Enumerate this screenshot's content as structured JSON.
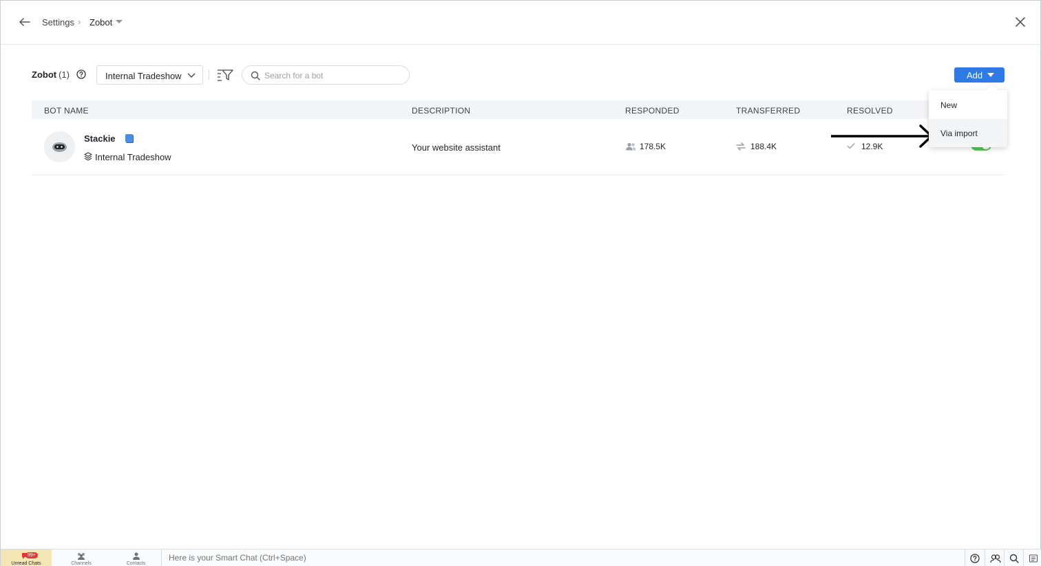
{
  "header": {
    "back_icon": "arrow-left-icon",
    "breadcrumb": {
      "settings": "Settings",
      "separator": "›",
      "current": "Zobot"
    },
    "close_icon": "close-icon"
  },
  "toolbar": {
    "title": "Zobot",
    "count": "(1)",
    "department_select": "Internal Tradeshow",
    "search_placeholder": "Search for a bot",
    "add_label": "Add"
  },
  "add_menu": {
    "items": [
      {
        "label": "New"
      },
      {
        "label": "Via import"
      }
    ],
    "highlighted": "Via import"
  },
  "table": {
    "columns": [
      "BOT NAME",
      "DESCRIPTION",
      "RESPONDED",
      "TRANSFERRED",
      "RESOLVED"
    ],
    "rows": [
      {
        "name": "Stackie",
        "department": "Internal Tradeshow",
        "description": "Your website assistant",
        "responded": "178.5K",
        "transferred": "188.4K",
        "resolved": "12.9K",
        "enabled": true
      }
    ]
  },
  "bottom_bar": {
    "unread_label": "Unread Chats",
    "unread_badge": "99+",
    "channels_label": "Channels",
    "contacts_label": "Contacts",
    "smart_chat_placeholder": "Here is your Smart Chat (Ctrl+Space)"
  },
  "colors": {
    "primary": "#2f7ae5",
    "toggle_on": "#5bc25d",
    "badge": "#e53935",
    "unread_tab": "#f5e6b5"
  }
}
